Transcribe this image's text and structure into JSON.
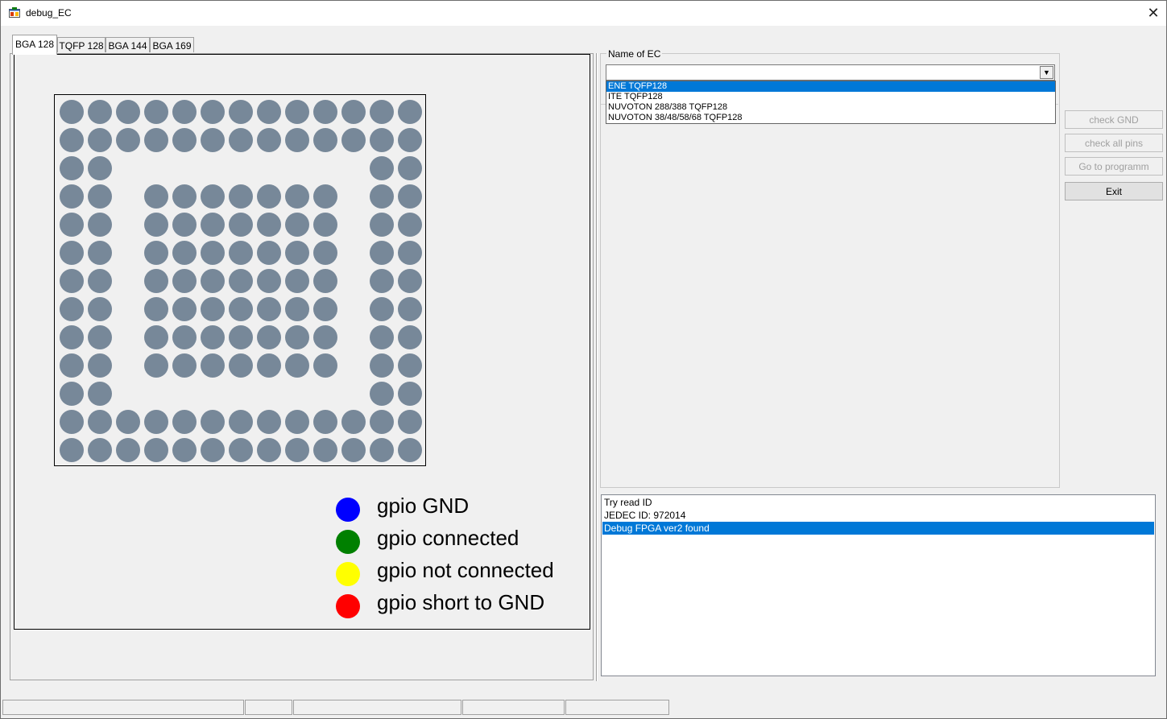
{
  "window": {
    "title": "debug_EC",
    "close_symbol": "✕"
  },
  "tabs": [
    {
      "label": "BGA 128",
      "active": true
    },
    {
      "label": "TQFP 128",
      "active": false
    },
    {
      "label": "BGA 144",
      "active": false
    },
    {
      "label": "BGA 169",
      "active": false
    }
  ],
  "pin_grid": {
    "rows": 13,
    "cols": 13,
    "pin_color": "#778899",
    "layout": [
      "1111111111111",
      "1111111111111",
      "1100000000011",
      "1100000000011",
      "1100000000011",
      "1100000000011",
      "1100000000011",
      "1100000000011",
      "1100000000011",
      "1100000000011",
      "1100000000011",
      "1111111111111",
      "1111111111111"
    ],
    "inner_block": {
      "row_start": 3,
      "row_end": 9,
      "col_start": 3,
      "col_end": 9
    }
  },
  "legend": [
    {
      "color": "#0000ff",
      "label": "gpio GND"
    },
    {
      "color": "#008000",
      "label": "gpio connected"
    },
    {
      "color": "#ffff00",
      "label": "gpio not connected"
    },
    {
      "color": "#ff0000",
      "label": "gpio short to GND"
    }
  ],
  "ec_group": {
    "title": "Name of EC",
    "combo_value": "",
    "options": [
      {
        "label": "ENE TQFP128",
        "selected": true
      },
      {
        "label": "ITE TQFP128",
        "selected": false
      },
      {
        "label": "NUVOTON 288/388 TQFP128",
        "selected": false
      },
      {
        "label": "NUVOTON 38/48/58/68 TQFP128",
        "selected": false
      }
    ]
  },
  "buttons": {
    "check_gnd": "check GND",
    "check_all_pins": "check all pins",
    "go_to_programm": "Go to programm",
    "exit": "Exit"
  },
  "log": [
    {
      "text": "Try read ID",
      "selected": false
    },
    {
      "text": "JEDEC ID: 972014",
      "selected": false
    },
    {
      "text": "Debug FPGA ver2 found",
      "selected": true
    }
  ],
  "colors": {
    "selection": "#0078d7",
    "pin": "#778899"
  }
}
